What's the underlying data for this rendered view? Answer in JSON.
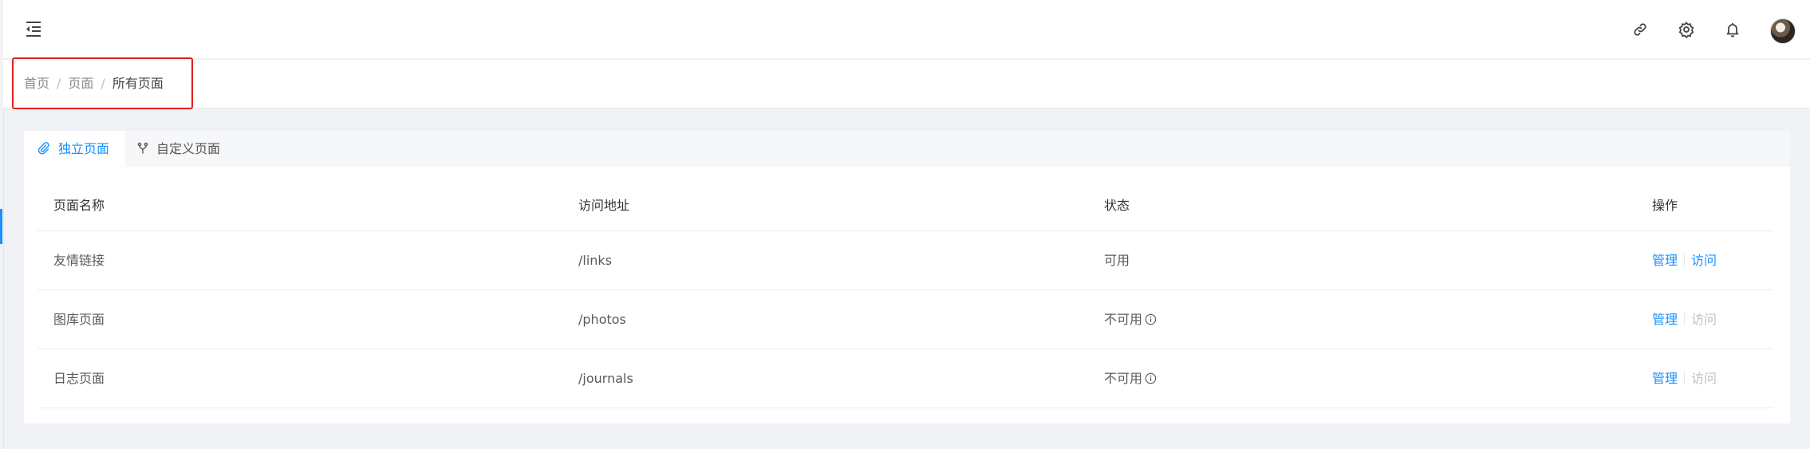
{
  "header": {
    "menu_icon": "menu-fold-icon",
    "icons": [
      "link-icon",
      "gear-icon",
      "bell-icon"
    ],
    "avatar": "user-avatar"
  },
  "breadcrumb": {
    "items": [
      "首页",
      "页面",
      "所有页面"
    ],
    "separator": "/"
  },
  "tabs": [
    {
      "label": "独立页面",
      "icon": "paperclip-icon",
      "active": true
    },
    {
      "label": "自定义页面",
      "icon": "fork-icon",
      "active": false
    }
  ],
  "table": {
    "columns": [
      "页面名称",
      "访问地址",
      "状态",
      "操作"
    ],
    "rows": [
      {
        "name": "友情链接",
        "path": "/links",
        "status": "可用",
        "status_info": false,
        "manage": "管理",
        "visit": "访问",
        "visit_enabled": true
      },
      {
        "name": "图库页面",
        "path": "/photos",
        "status": "不可用",
        "status_info": true,
        "manage": "管理",
        "visit": "访问",
        "visit_enabled": false
      },
      {
        "name": "日志页面",
        "path": "/journals",
        "status": "不可用",
        "status_info": true,
        "manage": "管理",
        "visit": "访问",
        "visit_enabled": false
      }
    ]
  },
  "colors": {
    "accent": "#1890ff",
    "highlight_border": "#e02020",
    "disabled": "#bfbfbf"
  }
}
